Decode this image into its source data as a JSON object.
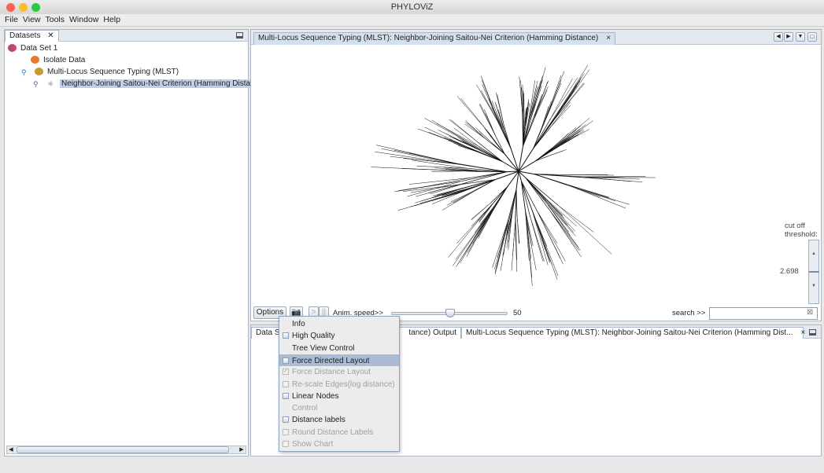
{
  "window": {
    "title": "PHYLOViZ"
  },
  "menubar": [
    "File",
    "View",
    "Tools",
    "Window",
    "Help"
  ],
  "datasets": {
    "tab": "Datasets",
    "close": "✕",
    "tree": [
      {
        "label": "Data Set 1",
        "icon": "dataset-icon"
      },
      {
        "label": "Isolate Data",
        "icon": "isolate-data-icon"
      },
      {
        "label": "Multi-Locus Sequence Typing (MLST)",
        "icon": "mlst-icon"
      },
      {
        "label": "Neighbor-Joining Saitou-Nei Criterion (Hamming Distan",
        "icon": "tree-algorithm-icon",
        "selected": true
      }
    ]
  },
  "viewer": {
    "tab": "Multi-Locus Sequence Typing (MLST): Neighbor-Joining Saitou-Nei Criterion (Hamming Distance)",
    "close": "×",
    "options": "Options",
    "play": ">",
    "pause": "||",
    "anim_label": "Anim. speed>>",
    "anim_speed": 50,
    "anim_min": 0,
    "anim_max": 100,
    "cutoff_label1": "cut off",
    "cutoff_label2": "threshold:",
    "cutoff_value": "2.698",
    "search_label": "search >>",
    "search_value": ""
  },
  "output": {
    "tabs": [
      "Data Se",
      "tance) Output",
      "Multi-Locus Sequence Typing (MLST): Neighbor-Joining Saitou-Nei Criterion (Hamming Dist..."
    ],
    "close": "×"
  },
  "options_menu": [
    {
      "label": "Info",
      "checkbox": false,
      "enabled": true
    },
    {
      "label": "High Quality",
      "checkbox": true,
      "checked": false,
      "enabled": true
    },
    {
      "label": "Tree View Control",
      "checkbox": false,
      "enabled": true
    },
    {
      "label": "Force Directed Layout",
      "checkbox": true,
      "checked": false,
      "enabled": true,
      "highlighted": true
    },
    {
      "label": "Force Distance Layout",
      "checkbox": true,
      "checked": true,
      "enabled": false
    },
    {
      "label": "Re-scale Edges(log distance)",
      "checkbox": true,
      "checked": false,
      "enabled": false
    },
    {
      "label": "Linear Nodes",
      "checkbox": true,
      "checked": false,
      "enabled": true
    },
    {
      "label": "Control",
      "checkbox": false,
      "enabled": false
    },
    {
      "label": "Distance labels",
      "checkbox": true,
      "checked": false,
      "enabled": true
    },
    {
      "label": "Round Distance Labels",
      "checkbox": true,
      "checked": false,
      "enabled": false
    },
    {
      "label": "Show Chart",
      "checkbox": true,
      "checked": false,
      "enabled": false
    }
  ]
}
